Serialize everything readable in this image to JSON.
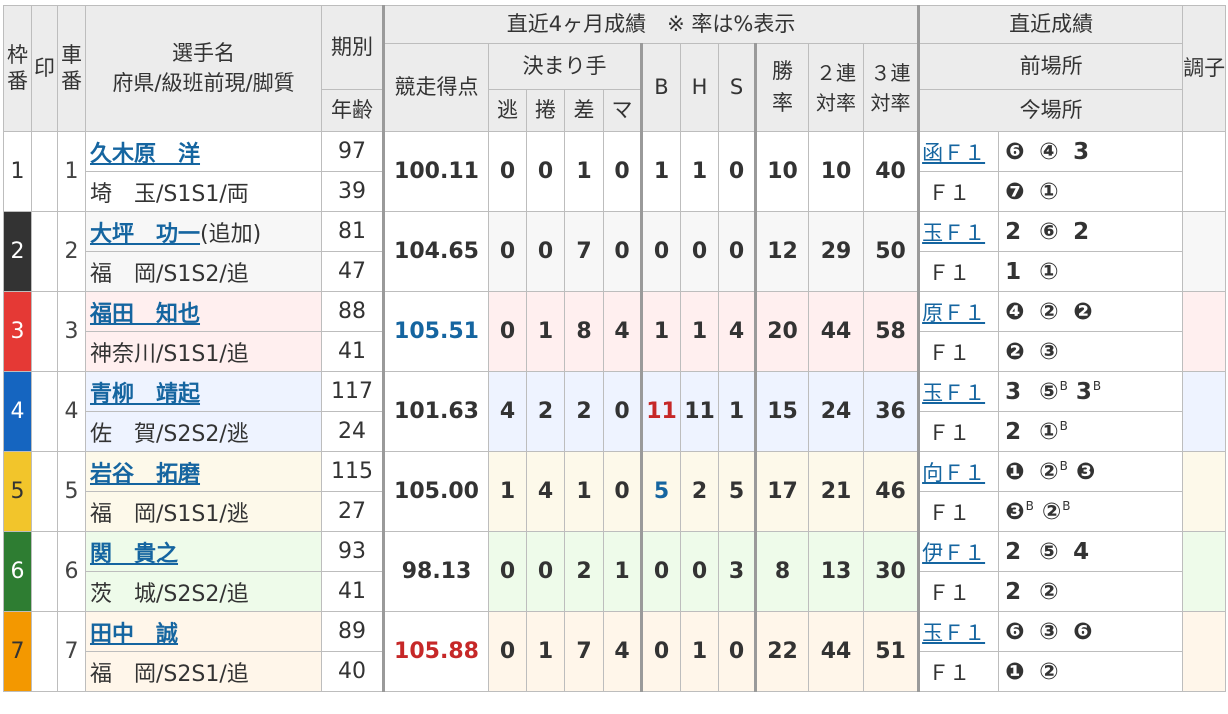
{
  "header": {
    "waku": "枠番",
    "mark": "印",
    "car": "車番",
    "player_top": "選手名",
    "player_bottom": "府県/級班前現/脚質",
    "period": "期別",
    "age": "年齢",
    "recent4": "直近4ヶ月成績　※ 率は%表示",
    "score": "競走得点",
    "kimarite": "決まり手",
    "nige": "逃",
    "makuri": "捲",
    "sashi": "差",
    "ma": "マ",
    "b": "B",
    "h": "H",
    "s": "S",
    "win_rate": "勝率",
    "two_rate": "２連対率",
    "three_rate": "３連対率",
    "recent_results": "直近成績",
    "prev_venue": "前場所",
    "curr_venue": "今場所",
    "condition": "調子"
  },
  "colors": {
    "waku1": "#ffffff",
    "waku2": "#333333",
    "waku3": "#e53935",
    "waku4": "#1565c0",
    "waku5": "#f2c52b",
    "waku6": "#2e7d32",
    "waku7": "#f39800"
  },
  "riders": [
    {
      "car": "1",
      "name": "久木原　洋",
      "note": "",
      "pref": "埼　玉/S1S1/両",
      "period": "97",
      "age": "39",
      "score": "100.11",
      "nige": "0",
      "makuri": "0",
      "sashi": "1",
      "ma": "0",
      "b": "1",
      "h": "1",
      "s": "0",
      "win": "10",
      "two": "10",
      "three": "40",
      "prev_venue": "函Ｆ１",
      "prev": [
        "❻",
        "④",
        "3"
      ],
      "prev_b": [
        "",
        "",
        ""
      ],
      "curr_venue": "Ｆ１",
      "curr": [
        "❼",
        "①"
      ],
      "curr_b": [
        "",
        ""
      ]
    },
    {
      "car": "2",
      "name": "大坪　功一",
      "note": "(追加)",
      "pref": "福　岡/S1S2/追",
      "period": "81",
      "age": "47",
      "score": "104.65",
      "nige": "0",
      "makuri": "0",
      "sashi": "7",
      "ma": "0",
      "b": "0",
      "h": "0",
      "s": "0",
      "win": "12",
      "two": "29",
      "three": "50",
      "prev_venue": "玉Ｆ１",
      "prev": [
        "2",
        "⑥",
        "2"
      ],
      "prev_b": [
        "",
        "",
        ""
      ],
      "curr_venue": "Ｆ１",
      "curr": [
        "1",
        "①"
      ],
      "curr_b": [
        "",
        ""
      ]
    },
    {
      "car": "3",
      "name": "福田　知也",
      "note": "",
      "pref": "神奈川/S1S1/追",
      "period": "88",
      "age": "41",
      "score": "105.51",
      "nige": "0",
      "makuri": "1",
      "sashi": "8",
      "ma": "4",
      "b": "1",
      "h": "1",
      "s": "4",
      "win": "20",
      "two": "44",
      "three": "58",
      "prev_venue": "原Ｆ１",
      "prev": [
        "❹",
        "②",
        "❷"
      ],
      "prev_b": [
        "",
        "",
        ""
      ],
      "curr_venue": "Ｆ１",
      "curr": [
        "❷",
        "③"
      ],
      "curr_b": [
        "",
        ""
      ]
    },
    {
      "car": "4",
      "name": "青柳　靖起",
      "note": "",
      "pref": "佐　賀/S2S2/逃",
      "period": "117",
      "age": "24",
      "score": "101.63",
      "nige": "4",
      "makuri": "2",
      "sashi": "2",
      "ma": "0",
      "b": "11",
      "h": "11",
      "s": "1",
      "win": "15",
      "two": "24",
      "three": "36",
      "prev_venue": "玉Ｆ１",
      "prev": [
        "3",
        "⑤",
        "3"
      ],
      "prev_b": [
        "",
        "B",
        "B"
      ],
      "curr_venue": "Ｆ１",
      "curr": [
        "2",
        "①"
      ],
      "curr_b": [
        "",
        "B"
      ]
    },
    {
      "car": "5",
      "name": "岩谷　拓磨",
      "note": "",
      "pref": "福　岡/S1S1/逃",
      "period": "115",
      "age": "27",
      "score": "105.00",
      "nige": "1",
      "makuri": "4",
      "sashi": "1",
      "ma": "0",
      "b": "5",
      "h": "2",
      "s": "5",
      "win": "17",
      "two": "21",
      "three": "46",
      "prev_venue": "向Ｆ１",
      "prev": [
        "❶",
        "②",
        "❸"
      ],
      "prev_b": [
        "",
        "B",
        ""
      ],
      "curr_venue": "Ｆ１",
      "curr": [
        "❸",
        "②"
      ],
      "curr_b": [
        "B",
        "B"
      ]
    },
    {
      "car": "6",
      "name": "関　貴之",
      "note": "",
      "pref": "茨　城/S2S2/追",
      "period": "93",
      "age": "41",
      "score": "98.13",
      "nige": "0",
      "makuri": "0",
      "sashi": "2",
      "ma": "1",
      "b": "0",
      "h": "0",
      "s": "3",
      "win": "8",
      "two": "13",
      "three": "30",
      "prev_venue": "伊Ｆ１",
      "prev": [
        "2",
        "⑤",
        "4"
      ],
      "prev_b": [
        "",
        "",
        ""
      ],
      "curr_venue": "Ｆ１",
      "curr": [
        "2",
        "②"
      ],
      "curr_b": [
        "",
        ""
      ]
    },
    {
      "car": "7",
      "name": "田中　誠",
      "note": "",
      "pref": "福　岡/S2S1/追",
      "period": "89",
      "age": "40",
      "score": "105.88",
      "nige": "0",
      "makuri": "1",
      "sashi": "7",
      "ma": "4",
      "b": "0",
      "h": "1",
      "s": "0",
      "win": "22",
      "two": "44",
      "three": "51",
      "prev_venue": "玉Ｆ１",
      "prev": [
        "❻",
        "③",
        "❻"
      ],
      "prev_b": [
        "",
        "",
        ""
      ],
      "curr_venue": "Ｆ１",
      "curr": [
        "❶",
        "②"
      ],
      "curr_b": [
        "",
        ""
      ]
    }
  ]
}
